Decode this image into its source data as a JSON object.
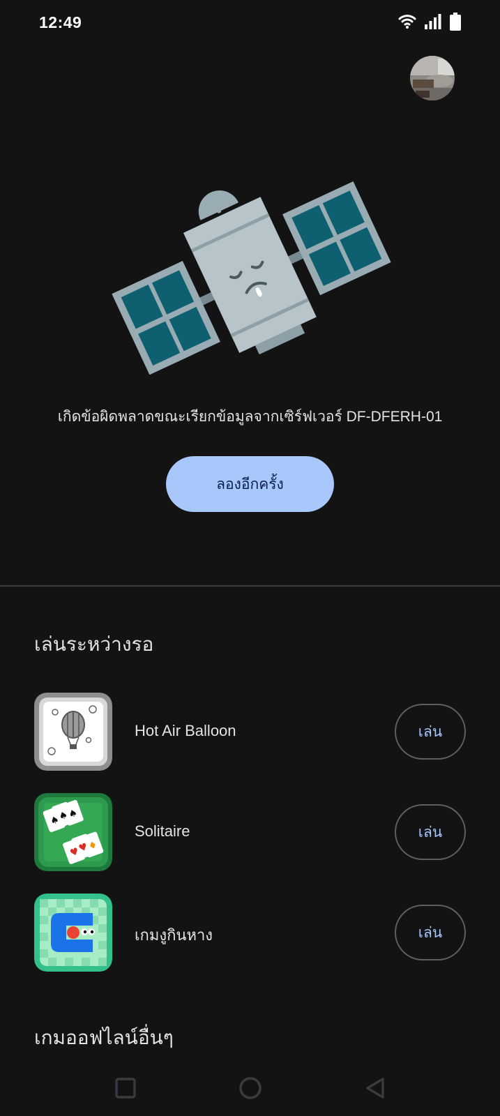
{
  "status_bar": {
    "time": "12:49",
    "icons": [
      "wifi-icon",
      "signal-icon",
      "battery-icon"
    ]
  },
  "error": {
    "message": "เกิดข้อผิดพลาดขณะเรียกข้อมูลจากเซิร์ฟเวอร์ DF-DFERH-01",
    "retry_label": "ลองอีกครั้ง"
  },
  "play_while_waiting": {
    "title": "เล่นระหว่างรอ",
    "games": [
      {
        "name": "Hot Air Balloon",
        "play_label": "เล่น",
        "icon": "hot-air-balloon-icon"
      },
      {
        "name": "Solitaire",
        "play_label": "เล่น",
        "icon": "solitaire-icon"
      },
      {
        "name": "เกมงูกินหาง",
        "play_label": "เล่น",
        "icon": "snake-game-icon"
      }
    ]
  },
  "offline_games": {
    "title": "เกมออฟไลน์อื่นๆ"
  },
  "colors": {
    "background": "#131314",
    "accent_button": "#a8c7fa",
    "accent_text": "#a8c7fa"
  }
}
